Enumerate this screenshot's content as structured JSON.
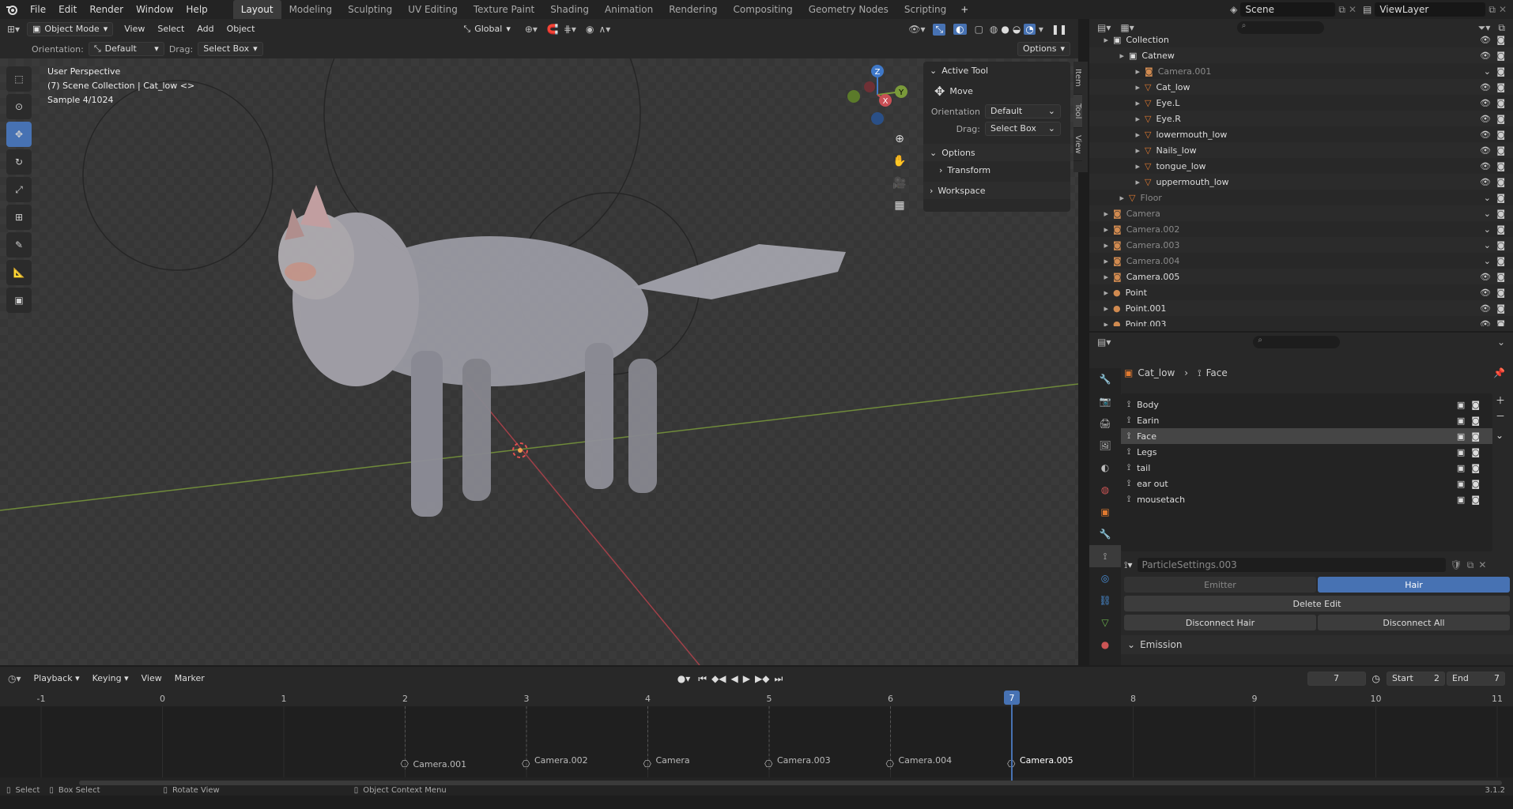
{
  "app": {
    "menus": [
      "File",
      "Edit",
      "Render",
      "Window",
      "Help"
    ],
    "workspaces": [
      "Layout",
      "Modeling",
      "Sculpting",
      "UV Editing",
      "Texture Paint",
      "Shading",
      "Animation",
      "Rendering",
      "Compositing",
      "Geometry Nodes",
      "Scripting"
    ],
    "active_workspace": "Layout",
    "scene": "Scene",
    "view_layer": "ViewLayer"
  },
  "viewport": {
    "mode": "Object Mode",
    "menus": [
      "View",
      "Select",
      "Add",
      "Object"
    ],
    "transform": "Global",
    "orientation_label": "Orientation:",
    "orientation": "Default",
    "drag_label": "Drag:",
    "drag": "Select Box",
    "options": "Options",
    "overlay_line1": "User Perspective",
    "overlay_line2": "(7) Scene Collection | Cat_low <>",
    "overlay_line3": "Sample 4/1024",
    "gizmo_axes": [
      "Z",
      "Y",
      "X"
    ]
  },
  "npanel": {
    "active_tool": "Active Tool",
    "move": "Move",
    "orientation_label": "Orientation",
    "orientation": "Default",
    "drag_label": "Drag:",
    "drag": "Select Box",
    "options": "Options",
    "transform": "Transform",
    "workspace": "Workspace",
    "tabs": [
      "Item",
      "Tool",
      "View"
    ]
  },
  "outliner": {
    "search_placeholder": "",
    "rows": [
      {
        "name": "Collection",
        "indent": 0
      },
      {
        "name": "Catnew",
        "indent": 1
      },
      {
        "name": "Camera.001",
        "indent": 2
      },
      {
        "name": "Cat_low",
        "indent": 2
      },
      {
        "name": "Eye.L",
        "indent": 2
      },
      {
        "name": "Eye.R",
        "indent": 2
      },
      {
        "name": "lowermouth_low",
        "indent": 2
      },
      {
        "name": "Nails_low",
        "indent": 2
      },
      {
        "name": "tongue_low",
        "indent": 2
      },
      {
        "name": "uppermouth_low",
        "indent": 2
      },
      {
        "name": "Floor",
        "indent": 1
      },
      {
        "name": "Camera",
        "indent": 0
      },
      {
        "name": "Camera.002",
        "indent": 0
      },
      {
        "name": "Camera.003",
        "indent": 0
      },
      {
        "name": "Camera.004",
        "indent": 0
      },
      {
        "name": "Camera.005",
        "indent": 0
      },
      {
        "name": "Point",
        "indent": 0
      },
      {
        "name": "Point.001",
        "indent": 0
      },
      {
        "name": "Point.003",
        "indent": 0
      }
    ]
  },
  "properties": {
    "breadcrumb_object": "Cat_low",
    "breadcrumb_data": "Face",
    "vertex_groups": [
      "Body",
      "Earin",
      "Face",
      "Legs",
      "tail",
      "ear out",
      "mousetach"
    ],
    "selected_group": "Face",
    "particle_settings": "ParticleSettings.003",
    "emitter": "Emitter",
    "hair": "Hair",
    "delete_edit": "Delete Edit",
    "disconnect_hair": "Disconnect Hair",
    "disconnect_all": "Disconnect All",
    "emission": "Emission"
  },
  "timeline": {
    "menus": [
      "Playback",
      "Keying",
      "View",
      "Marker"
    ],
    "current_frame": "7",
    "start_label": "Start",
    "start": "2",
    "end_label": "End",
    "end": "7",
    "ruler": [
      "-1",
      "0",
      "1",
      "2",
      "3",
      "4",
      "5",
      "6",
      "7",
      "8",
      "9",
      "10",
      "11"
    ],
    "markers": [
      "Camera.001",
      "Camera.002",
      "Camera",
      "Camera.003",
      "Camera.004",
      "Camera.005"
    ]
  },
  "status": {
    "items": [
      "Select",
      "Box Select",
      "Rotate View",
      "Object Context Menu"
    ],
    "version": "3.1.2"
  },
  "colors": {
    "accent": "#4772b3",
    "x_axis": "#c94f55",
    "y_axis": "#7a9a3a",
    "z_axis": "#3f78c8"
  }
}
